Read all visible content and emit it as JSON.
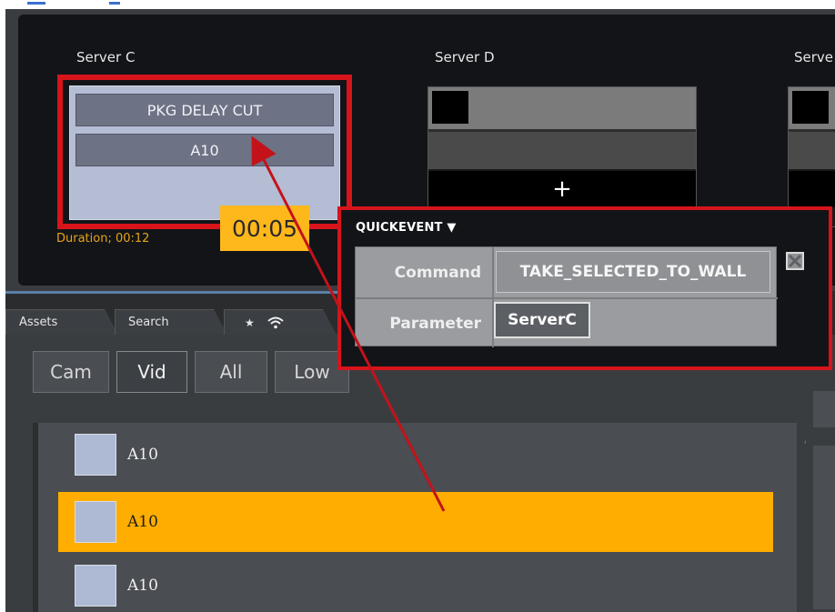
{
  "servers": [
    {
      "name": "Server C"
    },
    {
      "name": "Server D"
    },
    {
      "name": "Serve"
    }
  ],
  "server_c": {
    "title_row": "PKG DELAY CUT",
    "clip_row": "A10",
    "duration": "Duration; 00:12",
    "timer": "00:05"
  },
  "server_d": {
    "plus": "+"
  },
  "tabs": [
    {
      "label": "Assets"
    },
    {
      "label": "Search"
    }
  ],
  "tab_icons": {
    "star": "★",
    "wifi": "wifi-icon"
  },
  "filters": [
    {
      "label": "Cam",
      "active": false
    },
    {
      "label": "Vid",
      "active": true
    },
    {
      "label": "All",
      "active": false
    },
    {
      "label": "Low",
      "active": false
    }
  ],
  "list_items": [
    {
      "label": "A10",
      "selected": false
    },
    {
      "label": "A10",
      "selected": true
    },
    {
      "label": "A10",
      "selected": false
    }
  ],
  "quickevent": {
    "title": "QUICKEVENT ▼",
    "rows": [
      {
        "key": "Command",
        "value": "TAKE_SELECTED_TO_WALL"
      },
      {
        "key": "Parameter",
        "value": "ServerC"
      }
    ]
  },
  "colors": {
    "highlight_red": "#d8141b",
    "selected_row": "#ffad00",
    "timer_badge": "#ffb81c",
    "duration_text": "#e8a317"
  }
}
